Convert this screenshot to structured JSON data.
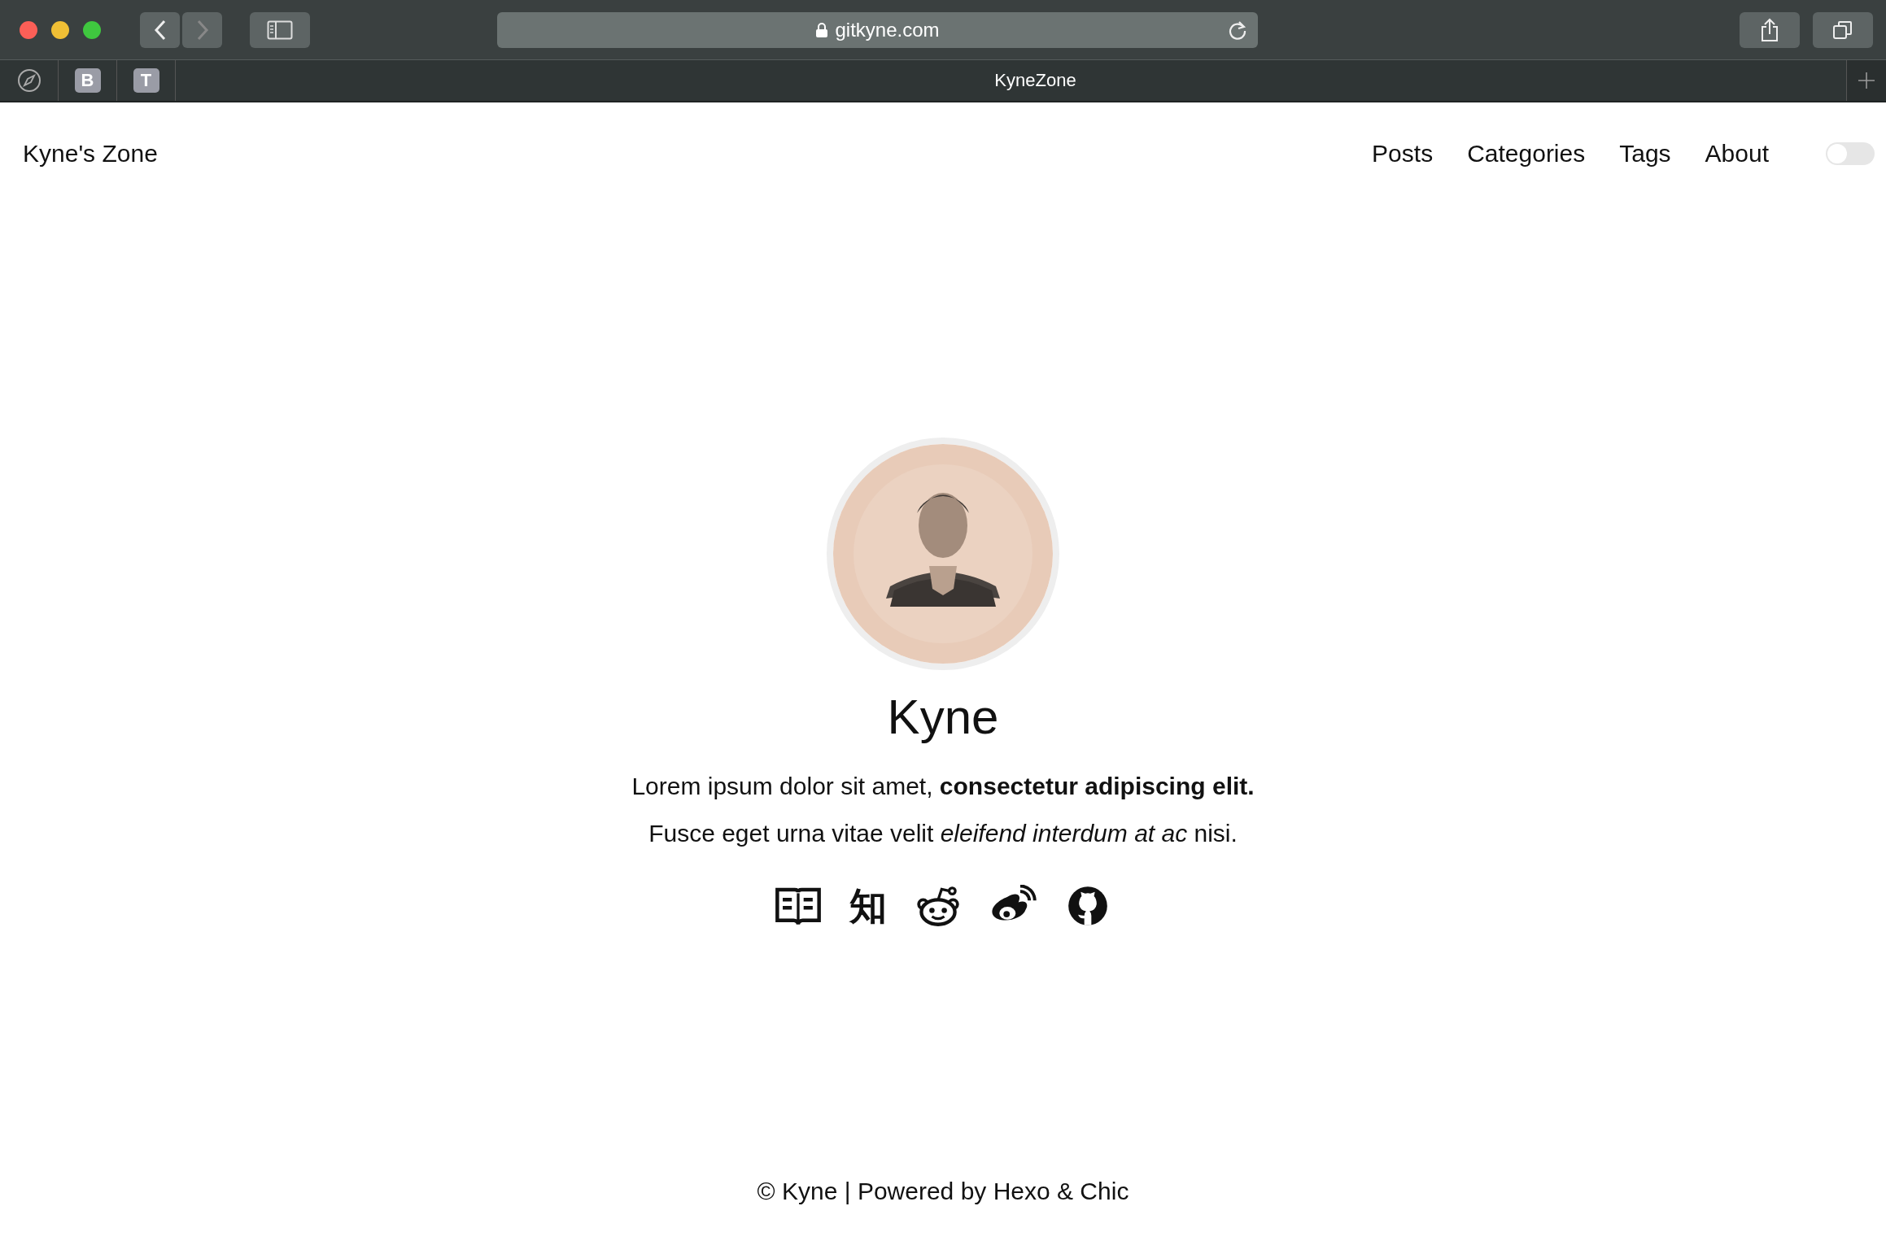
{
  "browser": {
    "address": "gitkyne.com",
    "pinned_tabs": [
      "B",
      "T"
    ],
    "tab_title": "KyneZone"
  },
  "site": {
    "brand": "Kyne's Zone",
    "nav": [
      {
        "label": "Posts"
      },
      {
        "label": "Categories"
      },
      {
        "label": "Tags"
      },
      {
        "label": "About"
      }
    ],
    "dark_mode_toggle": {
      "on": false
    }
  },
  "profile": {
    "name": "Kyne",
    "bio": [
      "Lorem ipsum dolor sit amet, **consectetur adipiscing elit.**",
      "Fusce eget urna vitae velit *eleifend interdum at ac* nisi."
    ],
    "links": [
      {
        "kind": "book"
      },
      {
        "kind": "glyph",
        "text": "知"
      },
      {
        "kind": "reddit"
      },
      {
        "kind": "weibo"
      },
      {
        "kind": "github"
      }
    ]
  },
  "footer": "© Kyne | Powered by Hexo & Chic"
}
